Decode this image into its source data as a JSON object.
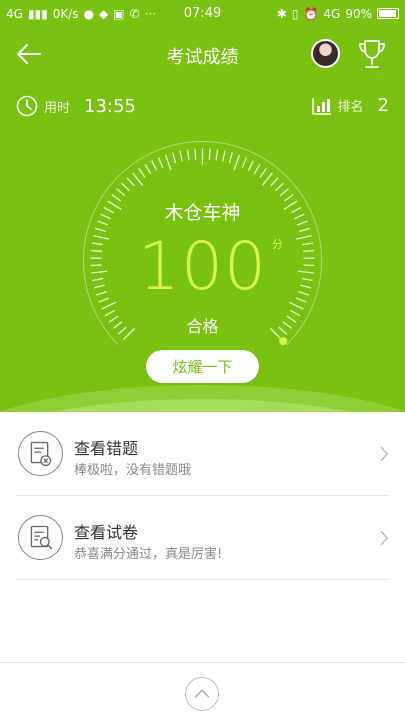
{
  "status_bar": {
    "network": "4G",
    "speed": "0K/s",
    "time": "07:49",
    "network_right": "4G",
    "battery": "90%"
  },
  "header": {
    "title": "考试成绩"
  },
  "stats": {
    "time_label": "用时",
    "time_value": "13:55",
    "rank_label": "排名",
    "rank_value": "2"
  },
  "result": {
    "user_name": "木仓车神",
    "score": "100",
    "score_unit": "分",
    "status": "合格",
    "share_button": "炫耀一下",
    "gauge_fraction": 1.0
  },
  "list": [
    {
      "title": "查看错题",
      "subtitle": "棒极啦，没有错题哦",
      "icon": "wrong-answers-icon"
    },
    {
      "title": "查看试卷",
      "subtitle": "恭喜满分通过，真是厉害!",
      "icon": "review-paper-icon"
    }
  ],
  "colors": {
    "primary": "#79c211",
    "score": "#d9f74a",
    "text": "#333333",
    "subtext": "#888888"
  }
}
